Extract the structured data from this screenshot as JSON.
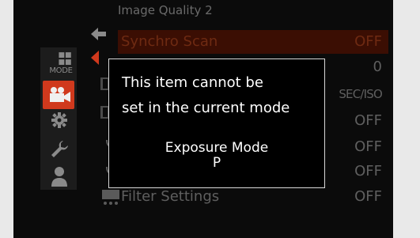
{
  "menu": {
    "title": "Image Quality 2",
    "mode_tab_label": "MODE",
    "rows": [
      {
        "name": "Synchro Scan",
        "value": "OFF"
      },
      {
        "name": "",
        "value": "0"
      },
      {
        "name": "",
        "value": "SEC/ISO"
      },
      {
        "name": "",
        "value": "OFF"
      },
      {
        "name": "",
        "value": "OFF"
      },
      {
        "name": "",
        "value": "OFF"
      },
      {
        "name": "Filter Settings",
        "value": "OFF"
      }
    ]
  },
  "dialog": {
    "message_line1": "This item cannot be",
    "message_line2": "set in the current mode",
    "exposure_label": "Exposure Mode",
    "exposure_value": "P"
  },
  "colors": {
    "active_tab": "#d0391d",
    "highlight_row": "#3b0e03",
    "screen_bg": "#0b0b0b"
  },
  "icons": [
    "back-arrow-icon",
    "video-camera-icon",
    "gear-icon",
    "wrench-icon",
    "person-icon",
    "microphone-icon",
    "film-icon"
  ]
}
